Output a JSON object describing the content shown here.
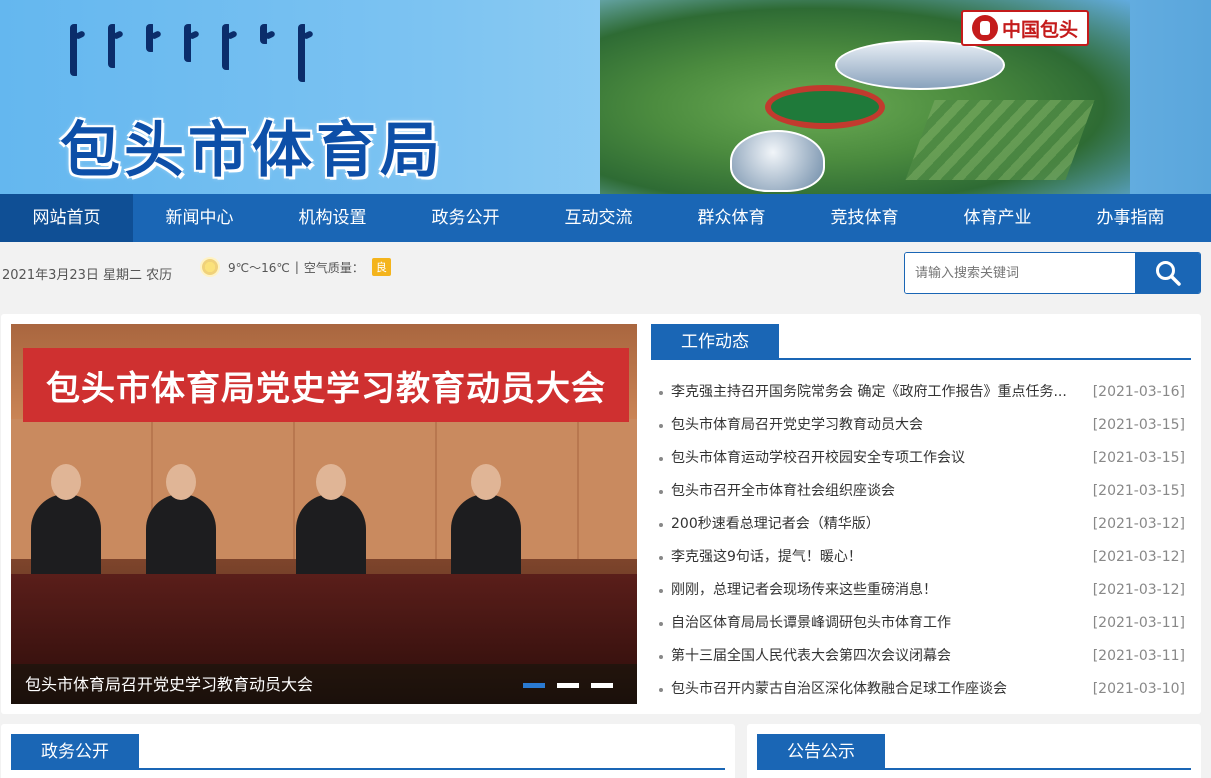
{
  "header": {
    "site_title": "包头市体育局",
    "brand_badge": "中国包头"
  },
  "nav": {
    "items": [
      {
        "label": "网站首页"
      },
      {
        "label": "新闻中心"
      },
      {
        "label": "机构设置"
      },
      {
        "label": "政务公开"
      },
      {
        "label": "互动交流"
      },
      {
        "label": "群众体育"
      },
      {
        "label": "竞技体育"
      },
      {
        "label": "体育产业"
      },
      {
        "label": "办事指南"
      }
    ]
  },
  "infobar": {
    "date": "2021年3月23日 星期二 农历",
    "temp": "9℃～16℃",
    "separator": "|",
    "air_label": "空气质量：",
    "air_value": "良",
    "search_placeholder": "请输入搜索关键词"
  },
  "slider": {
    "banner_text": "包头市体育局党史学习教育动员大会",
    "caption": "包头市体育局召开党史学习教育动员大会"
  },
  "news": {
    "title": "工作动态",
    "items": [
      {
        "title": "李克强主持召开国务院常务会 确定《政府工作报告》重点任务...",
        "date": "[2021-03-16]"
      },
      {
        "title": "包头市体育局召开党史学习教育动员大会",
        "date": "[2021-03-15]"
      },
      {
        "title": "包头市体育运动学校召开校园安全专项工作会议",
        "date": "[2021-03-15]"
      },
      {
        "title": "包头市召开全市体育社会组织座谈会",
        "date": "[2021-03-15]"
      },
      {
        "title": "200秒速看总理记者会（精华版）",
        "date": "[2021-03-12]"
      },
      {
        "title": "李克强这9句话，提气！暖心！",
        "date": "[2021-03-12]"
      },
      {
        "title": "刚刚，总理记者会现场传来这些重磅消息！",
        "date": "[2021-03-12]"
      },
      {
        "title": "自治区体育局局长谭景峰调研包头市体育工作",
        "date": "[2021-03-11]"
      },
      {
        "title": "第十三届全国人民代表大会第四次会议闭幕会",
        "date": "[2021-03-11]"
      },
      {
        "title": "包头市召开内蒙古自治区深化体教融合足球工作座谈会",
        "date": "[2021-03-10]"
      }
    ]
  },
  "panels": {
    "left_title": "政务公开",
    "right_title": "公告公示"
  },
  "colors": {
    "primary": "#1a66b5",
    "nav_active": "#0f4f95",
    "air_badge": "#f4b41c",
    "brand_red": "#c41b1b"
  }
}
